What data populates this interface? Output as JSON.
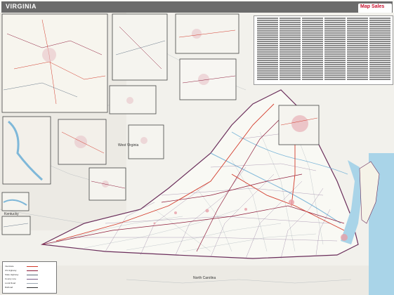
{
  "header": {
    "title": "VIRGINIA",
    "logo_text": "Map Sales"
  },
  "labels": {
    "west_virginia": "West Virginia",
    "north_carolina": "North Carolina",
    "kentucky": "Kentucky"
  },
  "colors": {
    "title_bar": "#6b6b6b",
    "land": "#f4f3ee",
    "water": "#a9d4e8",
    "interstate": "#d33a2a",
    "highway": "#8e1b3a",
    "county_line": "#7a5c8a",
    "local_road": "#6a7a8a",
    "inset_border": "#444444"
  },
  "legend": {
    "rows": [
      "Interstate",
      "US Highway",
      "State Highway",
      "County Line",
      "Local Road",
      "Railroad"
    ]
  }
}
